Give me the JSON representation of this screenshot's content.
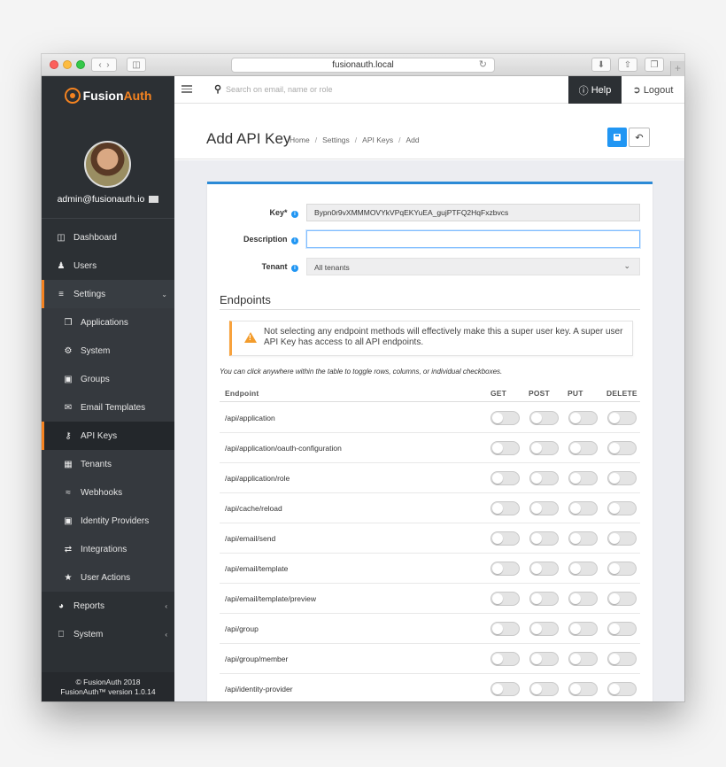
{
  "browser": {
    "address": "fusionauth.local"
  },
  "sidebar": {
    "brand_prefix": "Fusion",
    "brand_suffix": "Auth",
    "user_email": "admin@fusionauth.io",
    "items": [
      {
        "label": "Dashboard",
        "icon": "dashboard-icon",
        "level": "top"
      },
      {
        "label": "Users",
        "icon": "users-icon",
        "level": "top"
      },
      {
        "label": "Settings",
        "icon": "sliders-icon",
        "level": "top",
        "state": "open"
      },
      {
        "label": "Applications",
        "icon": "cube-icon",
        "level": "sub"
      },
      {
        "label": "System",
        "icon": "cog-icon",
        "level": "sub"
      },
      {
        "label": "Groups",
        "icon": "group-icon",
        "level": "sub"
      },
      {
        "label": "Email Templates",
        "icon": "envelope-icon",
        "level": "sub"
      },
      {
        "label": "API Keys",
        "icon": "key-icon",
        "level": "sub",
        "state": "active"
      },
      {
        "label": "Tenants",
        "icon": "building-icon",
        "level": "sub"
      },
      {
        "label": "Webhooks",
        "icon": "rss-icon",
        "level": "sub"
      },
      {
        "label": "Identity Providers",
        "icon": "id-badge-icon",
        "level": "sub"
      },
      {
        "label": "Integrations",
        "icon": "exchange-icon",
        "level": "sub"
      },
      {
        "label": "User Actions",
        "icon": "trophy-icon",
        "level": "sub"
      },
      {
        "label": "Reports",
        "icon": "pie-chart-icon",
        "level": "top"
      },
      {
        "label": "System",
        "icon": "desktop-icon",
        "level": "top"
      }
    ],
    "footer_line1": "© FusionAuth 2018",
    "footer_line2": "FusionAuth™ version 1.0.14"
  },
  "topbar": {
    "search_placeholder": "Search on email, name or role",
    "help_label": "Help",
    "logout_label": "Logout"
  },
  "page": {
    "title": "Add API Key",
    "breadcrumbs": [
      "Home",
      "Settings",
      "API Keys",
      "Add"
    ]
  },
  "form": {
    "key_label": "Key*",
    "key_value": "Bypn0r9vXMMMOVYkVPqEKYuEA_gujPTFQ2HqFxzbvcs",
    "description_label": "Description",
    "description_value": "",
    "tenant_label": "Tenant",
    "tenant_value": "All tenants"
  },
  "endpoints": {
    "section_title": "Endpoints",
    "alert": "Not selecting any endpoint methods will effectively make this a super user key. A super user API Key has access to all API endpoints.",
    "hint": "You can click anywhere within the table to toggle rows, columns, or individual checkboxes.",
    "columns": [
      "Endpoint",
      "GET",
      "POST",
      "PUT",
      "DELETE"
    ],
    "rows": [
      "/api/application",
      "/api/application/oauth-configuration",
      "/api/application/role",
      "/api/cache/reload",
      "/api/email/send",
      "/api/email/template",
      "/api/email/template/preview",
      "/api/group",
      "/api/group/member",
      "/api/identity-provider"
    ]
  },
  "colors": {
    "accent": "#f58320",
    "primary": "#2196f3",
    "sidebar_bg": "#2c3034",
    "warning": "#f39c2c"
  }
}
